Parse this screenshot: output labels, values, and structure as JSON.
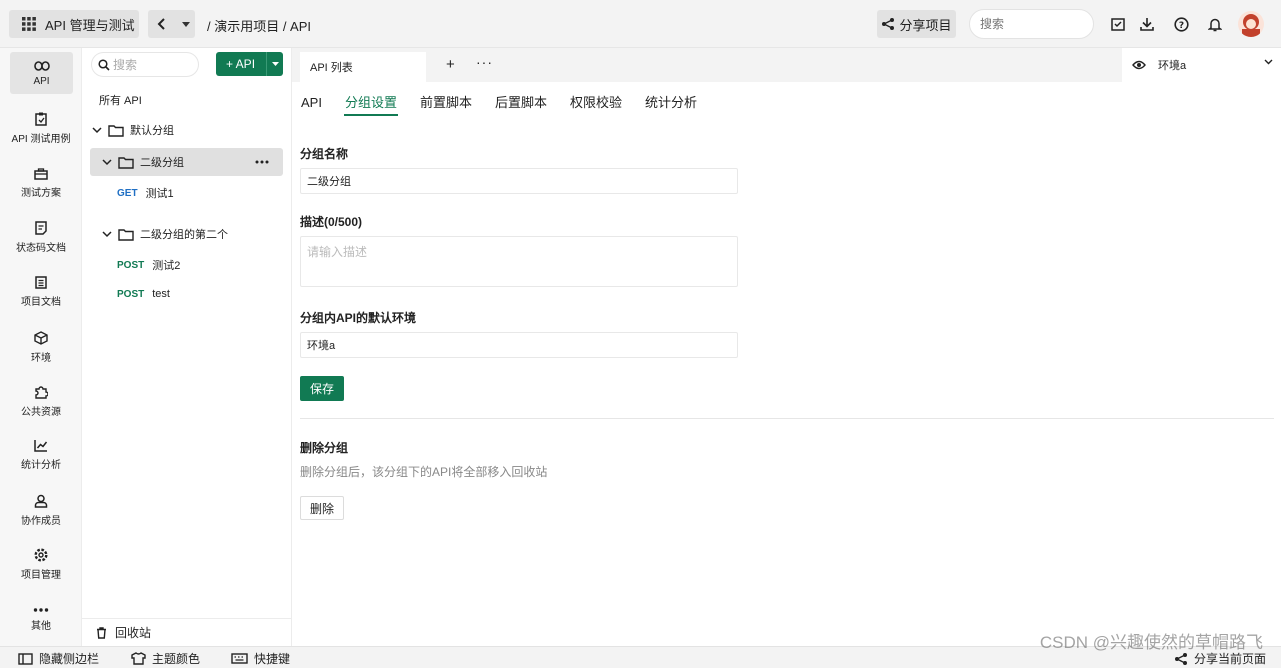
{
  "topbar": {
    "app_label": "API 管理与测试",
    "breadcrumb": "/ 演示用项目 / API",
    "share_label": "分享项目",
    "search_placeholder": "搜索"
  },
  "leftnav": [
    {
      "label": "API",
      "icon": "link-icon"
    },
    {
      "label": "API 测试用例",
      "icon": "clipboard-icon"
    },
    {
      "label": "测试方案",
      "icon": "case-icon"
    },
    {
      "label": "状态码文档",
      "icon": "doc-icon"
    },
    {
      "label": "项目文档",
      "icon": "notes-icon"
    },
    {
      "label": "环境",
      "icon": "cube-icon"
    },
    {
      "label": "公共资源",
      "icon": "puzzle-icon"
    },
    {
      "label": "统计分析",
      "icon": "chart-icon"
    },
    {
      "label": "协作成员",
      "icon": "members-icon"
    },
    {
      "label": "项目管理",
      "icon": "gear-icon"
    },
    {
      "label": "其他",
      "icon": "more-icon"
    }
  ],
  "tree": {
    "search_placeholder": "搜索",
    "add_label": "+ API",
    "all_label": "所有 API",
    "default_group": "默认分组",
    "sub_group": "二级分组",
    "get_method": "GET",
    "get_name": "测试1",
    "second_group": "二级分组的第二个",
    "post1_method": "POST",
    "post1_name": "测试2",
    "post2_method": "POST",
    "post2_name": "test",
    "recycle_label": "回收站"
  },
  "tabs": {
    "open_tab": "API 列表",
    "env_label": "环境a"
  },
  "subtabs": [
    "API",
    "分组设置",
    "前置脚本",
    "后置脚本",
    "权限校验",
    "统计分析"
  ],
  "form": {
    "name_label": "分组名称",
    "name_value": "二级分组",
    "desc_label": "描述(0/500)",
    "desc_placeholder": "请输入描述",
    "env_label": "分组内API的默认环境",
    "env_value": "环境a",
    "save_label": "保存",
    "delete_title": "删除分组",
    "delete_desc": "删除分组后，该分组下的API将全部移入回收站",
    "delete_label": "删除"
  },
  "bottombar": {
    "hide_sidebar": "隐藏侧边栏",
    "theme": "主题颜色",
    "shortcuts": "快捷键",
    "share_page": "分享当前页面"
  },
  "watermark": "CSDN @兴趣使然的草帽路飞",
  "colors": {
    "accent": "#117a53",
    "get": "#1f6fc4"
  }
}
